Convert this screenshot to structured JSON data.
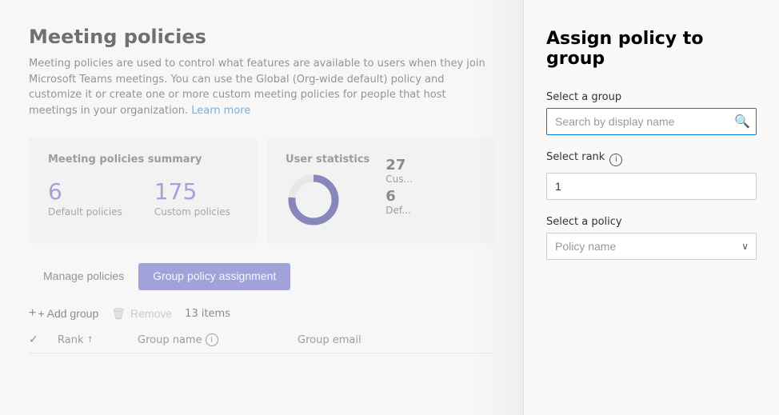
{
  "page": {
    "title": "Meeting policies",
    "description": "Meeting policies are used to control what features are available to users when they join Microsoft Teams meetings. You can use the Global (Org-wide default) policy and customize it or create one or more custom meeting policies for people that host meetings in your organization.",
    "learn_more": "Learn more"
  },
  "summary_card": {
    "title": "Meeting policies summary",
    "default_count": "6",
    "default_label": "Default policies",
    "custom_count": "175",
    "custom_label": "Custom policies"
  },
  "user_stats_card": {
    "title": "User statistics",
    "custom_count": "27",
    "custom_label": "Cus...",
    "default_count": "6",
    "default_label": "Def..."
  },
  "tabs": [
    {
      "id": "manage",
      "label": "Manage policies"
    },
    {
      "id": "group",
      "label": "Group policy assignment"
    }
  ],
  "toolbar": {
    "add_label": "+ Add group",
    "remove_label": "Remove",
    "items_count": "13 items"
  },
  "table": {
    "columns": [
      {
        "id": "rank",
        "label": "Rank",
        "sortable": true
      },
      {
        "id": "group_name",
        "label": "Group name",
        "info": true
      },
      {
        "id": "group_email",
        "label": "Group email"
      }
    ]
  },
  "right_panel": {
    "title": "Assign policy to group",
    "select_group_label": "Select a group",
    "search_placeholder": "Search by display name",
    "select_rank_label": "Select rank",
    "rank_value": "1",
    "select_policy_label": "Select a policy",
    "policy_placeholder": "Policy name",
    "policy_options": [
      "Policy name"
    ]
  },
  "icons": {
    "search": "🔍",
    "info": "i",
    "sort_asc": "↑",
    "chevron_down": "∨",
    "remove_icon": "🗑",
    "plus": "+"
  }
}
